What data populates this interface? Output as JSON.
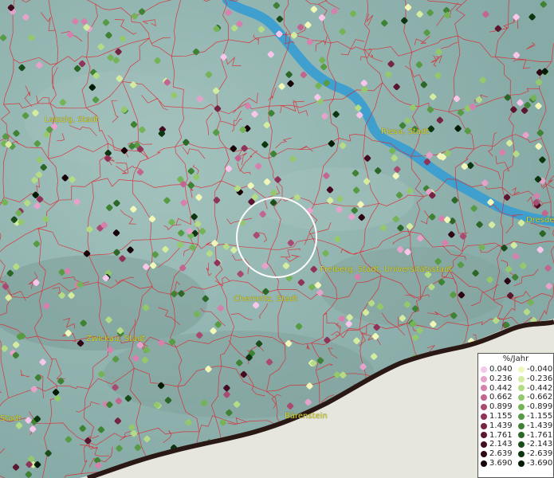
{
  "legend": {
    "title": "%/Jahr",
    "positive": [
      {
        "label": "0.040",
        "color": "#f7c6ea"
      },
      {
        "label": "0.236",
        "color": "#e7a2cc"
      },
      {
        "label": "0.442",
        "color": "#d681ad"
      },
      {
        "label": "0.662",
        "color": "#c26590"
      },
      {
        "label": "0.899",
        "color": "#a94a72"
      },
      {
        "label": "1.155",
        "color": "#8f3359"
      },
      {
        "label": "1.439",
        "color": "#752443"
      },
      {
        "label": "1.761",
        "color": "#5b1630"
      },
      {
        "label": "2.143",
        "color": "#440c20"
      },
      {
        "label": "2.639",
        "color": "#2e0613"
      },
      {
        "label": "3.690",
        "color": "#170208"
      }
    ],
    "negative": [
      {
        "label": "-0.040",
        "color": "#f0f7b8"
      },
      {
        "label": "-0.236",
        "color": "#d4eca0"
      },
      {
        "label": "-0.442",
        "color": "#b4dc86"
      },
      {
        "label": "-0.662",
        "color": "#93c96c"
      },
      {
        "label": "-0.899",
        "color": "#74b457"
      },
      {
        "label": "-1.155",
        "color": "#579c44"
      },
      {
        "label": "-1.439",
        "color": "#3f8234"
      },
      {
        "label": "-1.761",
        "color": "#2b6726"
      },
      {
        "label": "-2.143",
        "color": "#1a4d1a"
      },
      {
        "label": "-2.639",
        "color": "#0d3510"
      },
      {
        "label": "-3.690",
        "color": "#031c06"
      }
    ]
  },
  "cities": [
    {
      "name": "Leipzig, Stadt"
    },
    {
      "name": "Riesa, Stadt"
    },
    {
      "name": "Dresden"
    },
    {
      "name": "Freiberg, Stadt, Universitätsstadt"
    },
    {
      "name": "Chemnitz, Stadt"
    },
    {
      "name": "Zwickau, Stadt"
    },
    {
      "name": "Stadt"
    },
    {
      "name": "Bärenstein"
    }
  ],
  "colors": {
    "land": "#94b7b3",
    "river": "#3f9fcf",
    "boundary": "#e0212a",
    "snow": "#e6e6dc",
    "border_line": "#2a1814",
    "city_label": "#d8d820",
    "selection_circle": "#ffffff"
  }
}
